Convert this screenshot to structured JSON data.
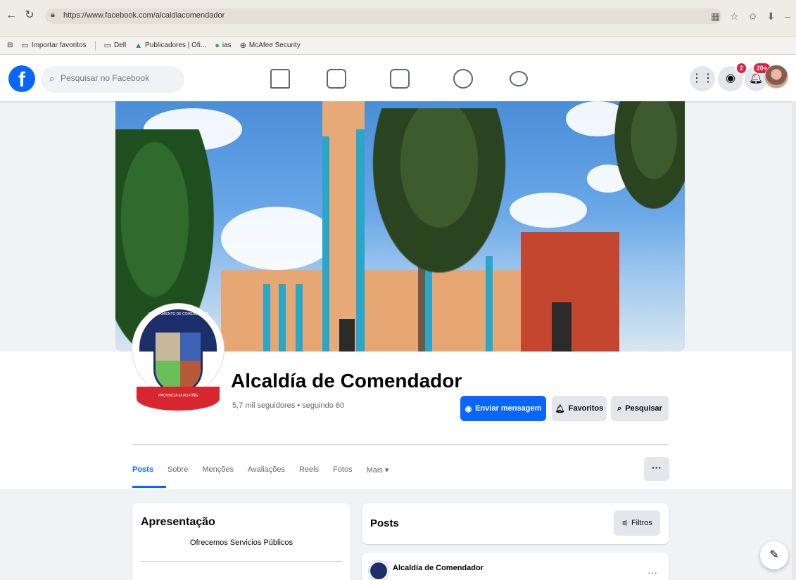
{
  "browser": {
    "url": "https://www.facebook.com/alcaldiacomendador",
    "bookmarks": [
      "Importar favoritos",
      "Dell",
      "Publicadores | Ofi...",
      "ias",
      "McAfee Security"
    ]
  },
  "fb": {
    "search_placeholder": "Pesquisar no Facebook",
    "messenger_badge": "2",
    "notif_badge": "20+"
  },
  "profile": {
    "name": "Alcaldía de Comendador",
    "followers": "5,7 mil seguidores • seguindo 60",
    "send_message": "Enviar mensagem",
    "favorites": "Favoritos",
    "search": "Pesquisar",
    "seal_top": "AYUNTAMIENTO DE COMENDADOR",
    "seal_bottom": "PROVINCIA ELIAS PIÑA"
  },
  "tabs": [
    "Posts",
    "Sobre",
    "Menções",
    "Avaliações",
    "Reels",
    "Fotos",
    "Mais ▾"
  ],
  "intro": {
    "title": "Apresentação",
    "bio": "Ofrecemos Servicios Públicos"
  },
  "posts": {
    "title": "Posts",
    "filter": "Filtros",
    "first_author": "Alcaldía de Comendador"
  },
  "colors": {
    "fb_blue": "#0866ff",
    "badge_red": "#e41e3f"
  }
}
